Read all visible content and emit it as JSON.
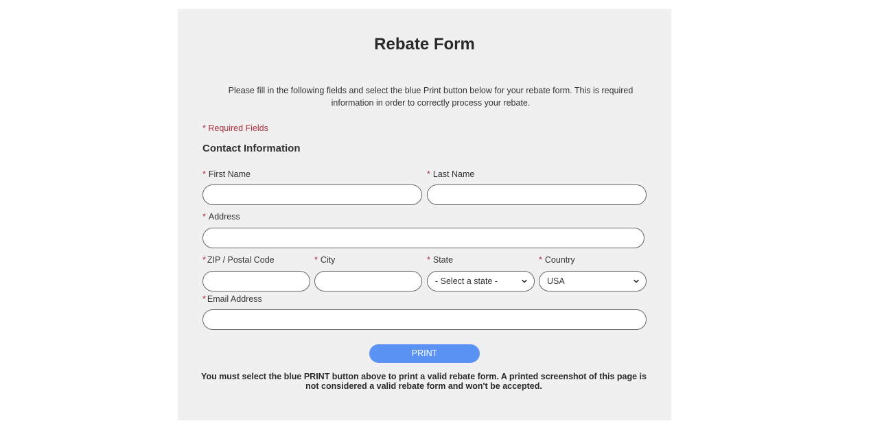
{
  "form": {
    "title": "Rebate Form",
    "intro": "Please fill in the following fields and select the blue Print button below for your rebate form. This is required information in order to correctly process your rebate.",
    "required_note": "* Required Fields",
    "section_title": "Contact Information",
    "required_star": "*",
    "fields": {
      "first_name": {
        "label": "First Name",
        "value": "",
        "placeholder": ""
      },
      "last_name": {
        "label": "Last Name",
        "value": "",
        "placeholder": ""
      },
      "address": {
        "label": "Address",
        "value": "",
        "placeholder": ""
      },
      "zip": {
        "label": "ZIP / Postal Code",
        "value": "",
        "placeholder": ""
      },
      "city": {
        "label": "City",
        "value": "",
        "placeholder": ""
      },
      "state": {
        "label": "State",
        "selected": "- Select a state -"
      },
      "country": {
        "label": "Country",
        "selected": "USA"
      },
      "email": {
        "label": "Email Address",
        "value": "",
        "placeholder": ""
      }
    },
    "print_label": "PRINT",
    "footer_note": "You must select the blue PRINT button above to print a valid rebate form. A printed screenshot of this page is not considered a valid rebate form and won't be accepted."
  },
  "colors": {
    "panel_bg": "#f0f0f0",
    "required_red": "#a8323e",
    "print_blue": "#5b93f5"
  },
  "icons": {
    "state_dropdown": "chevron-down-icon",
    "country_dropdown": "chevron-down-icon"
  }
}
